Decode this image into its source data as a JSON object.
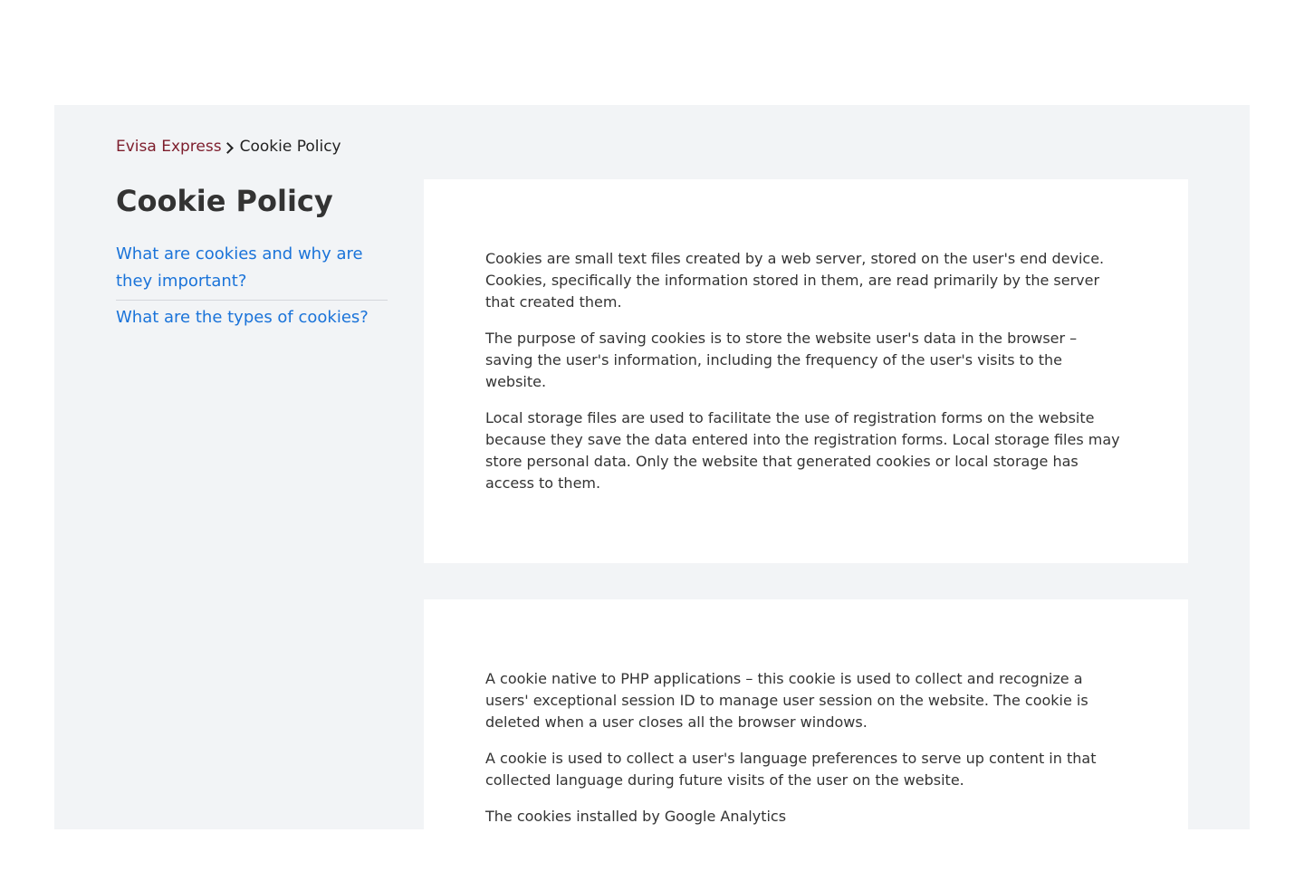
{
  "breadcrumb": {
    "home": "Evisa Express",
    "current": "Cookie Policy"
  },
  "sidebar": {
    "title": "Cookie Policy",
    "toc": [
      "What are cookies and why are they important?",
      "What are the types of cookies?"
    ]
  },
  "sections": [
    {
      "paragraphs": [
        "Cookies are small text files created by a web server, stored on the user's end device. Cookies, specifically the information stored in them, are read primarily by the server that created them.",
        "The purpose of saving cookies is to store the website user's data in the browser – saving the user's information, including the frequency of the user's visits to the website.",
        "Local storage files are used to facilitate the use of registration forms on the website because they save the data entered into the registration forms. Local storage files may store personal data. Only the website that generated cookies or local storage has access to them."
      ]
    },
    {
      "paragraphs": [
        "A cookie native to PHP applications – this cookie is used to collect and recognize a users' exceptional session ID to manage user session on the website. The cookie is deleted when a user closes all the browser windows.",
        "A cookie is used to collect a user's language preferences to serve up content in that collected language during future visits of the user on the website.",
        "The cookies installed by Google Analytics"
      ]
    }
  ]
}
